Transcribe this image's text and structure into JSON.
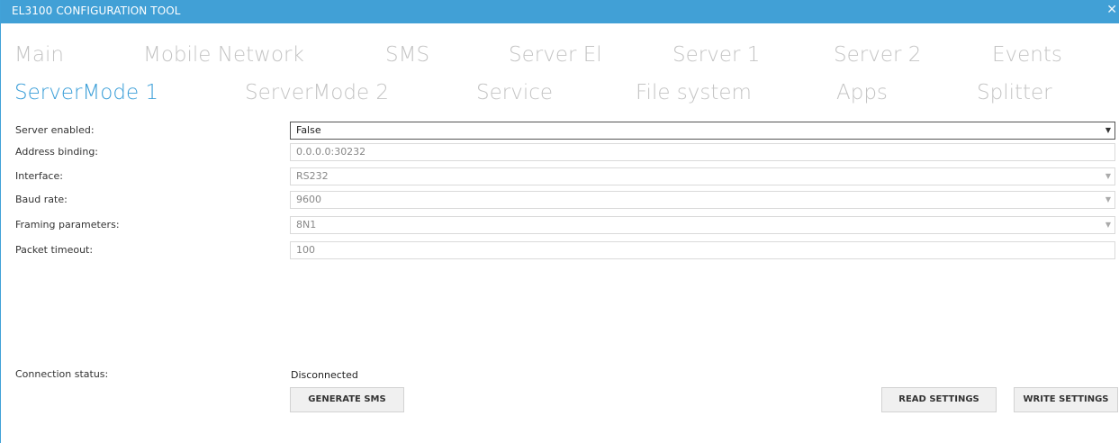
{
  "window": {
    "title": "EL3100 CONFIGURATION TOOL",
    "close_glyph": "✕"
  },
  "tabs_row1": [
    "Main",
    "Mobile Network",
    "SMS",
    "Server El",
    "Server 1",
    "Server 2",
    "Events"
  ],
  "tabs_row2": [
    "ServerMode 1",
    "ServerMode 2",
    "Service",
    "File system",
    "Apps",
    "Splitter"
  ],
  "active_tab": "ServerMode 1",
  "form": {
    "server_enabled": {
      "label": "Server enabled:",
      "value": "False"
    },
    "address_binding": {
      "label": "Address binding:",
      "value": "0.0.0.0:30232"
    },
    "interface": {
      "label": "Interface:",
      "value": "RS232"
    },
    "baud_rate": {
      "label": "Baud rate:",
      "value": "9600"
    },
    "framing": {
      "label": "Framing parameters:",
      "value": "8N1"
    },
    "packet_timeout": {
      "label": "Packet timeout:",
      "value": "100"
    }
  },
  "connection": {
    "label": "Connection status:",
    "value": "Disconnected"
  },
  "buttons": {
    "generate_sms": "GENERATE SMS",
    "read_settings": "READ SETTINGS",
    "write_settings": "WRITE SETTINGS"
  },
  "dropdown_glyph": "▼",
  "colors": {
    "accent": "#41a0d6",
    "active_tab": "#3a9ed8",
    "inactive_tab": "#c4c4c4"
  }
}
